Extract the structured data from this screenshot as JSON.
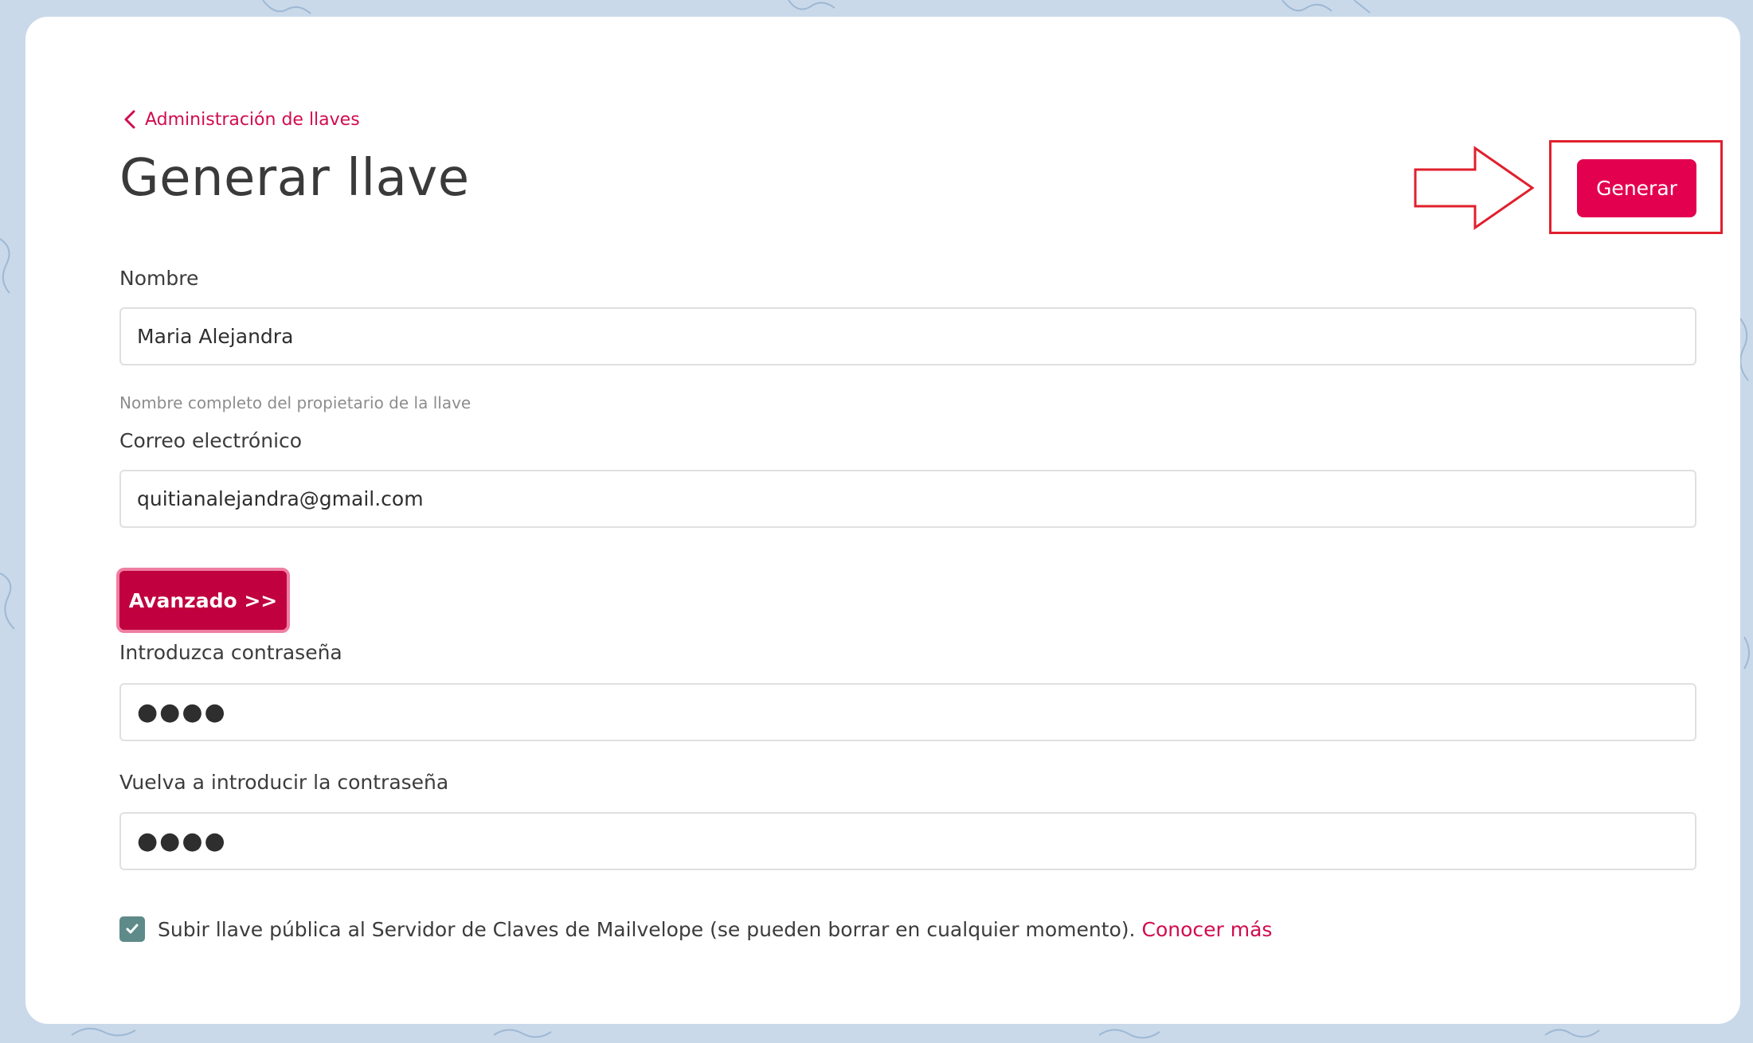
{
  "breadcrumb": {
    "back_label": "Administración de llaves"
  },
  "page": {
    "title": "Generar llave"
  },
  "actions": {
    "generate_label": "Generar",
    "advanced_label": "Avanzado >>"
  },
  "form": {
    "name": {
      "label": "Nombre",
      "value": "Maria Alejandra",
      "help": "Nombre completo del propietario de la llave"
    },
    "email": {
      "label": "Correo electrónico",
      "value": "quitianalejandra@gmail.com"
    },
    "password": {
      "label": "Introduzca contraseña",
      "value": "●●●●"
    },
    "password_confirm": {
      "label": "Vuelva a introducir la contraseña",
      "value": "●●●●"
    },
    "upload_checkbox": {
      "checked": true,
      "label": "Subir llave pública al Servidor de Claves de Mailvelope (se pueden borrar en cualquier momento).",
      "link_label": "Conocer más"
    }
  },
  "colors": {
    "accent": "#e3004f",
    "advanced_button": "#c0003f",
    "annotation": "#e0202d",
    "checkbox": "#5e8b8a",
    "background": "#c9d9ea"
  },
  "icons": {
    "back": "chevron-left-icon",
    "check": "check-icon",
    "annotation_arrow": "arrow-right-icon"
  }
}
